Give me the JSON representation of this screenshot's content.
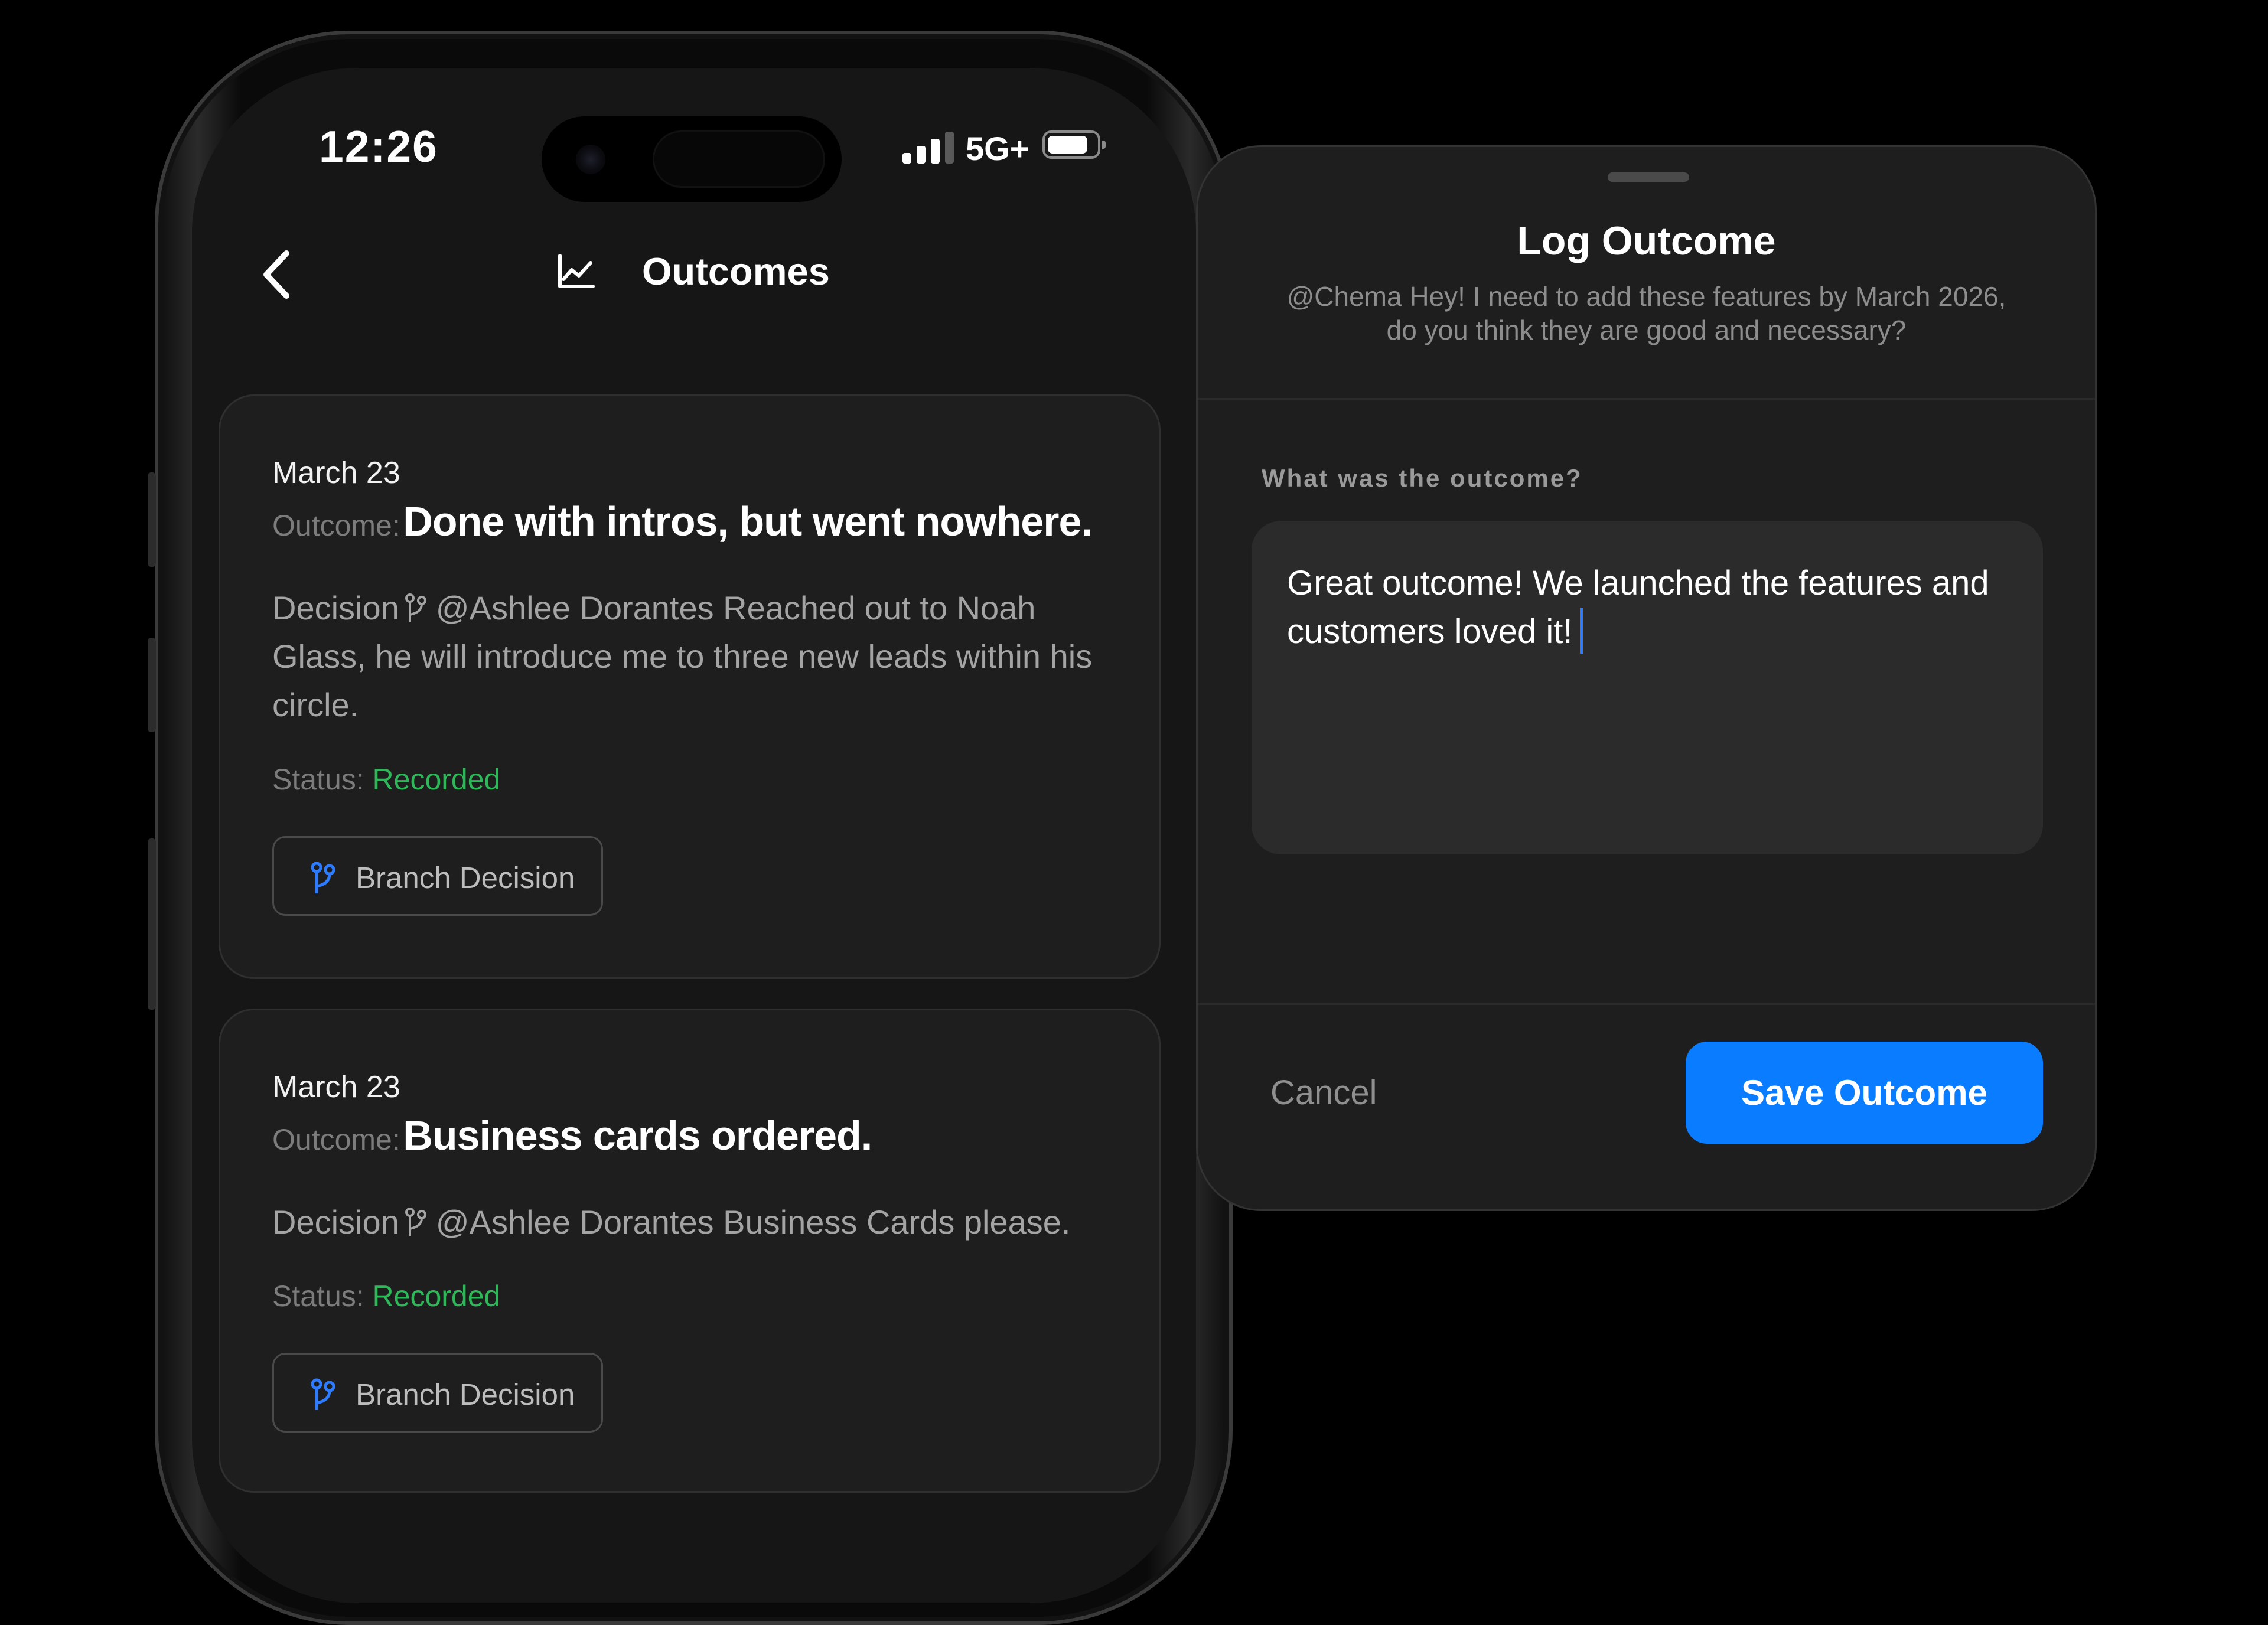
{
  "status_bar": {
    "time": "12:26",
    "network": "5G+",
    "signal_bars": 4,
    "signal_bars_active": 3,
    "battery_level": 0.8
  },
  "nav": {
    "title": "Outcomes",
    "back_icon": "chevron-left-icon",
    "title_icon": "trend-chart-icon"
  },
  "cards": [
    {
      "date": "March 23",
      "outcome_label": "Outcome:",
      "outcome": "Done with intros, but went nowhere.",
      "decision_label": "Decision",
      "decision_text": "@Ashlee Dorantes Reached out to Noah Glass, he will introduce me to three new leads within his circle.",
      "status_label": "Status:",
      "status": "Recorded",
      "button_label": "Branch Decision"
    },
    {
      "date": "March 23",
      "outcome_label": "Outcome:",
      "outcome": "Business cards ordered.",
      "decision_label": "Decision",
      "decision_text": "@Ashlee Dorantes Business Cards please.",
      "status_label": "Status:",
      "status": "Recorded",
      "button_label": "Branch Decision"
    }
  ],
  "sheet": {
    "title": "Log Outcome",
    "subtitle": "@Chema Hey! I need to add these features by March 2026, do you think they are good and necessary?",
    "field_label": "What was the outcome?",
    "field_value": "Great outcome! We launched the features and customers loved it!",
    "cancel_label": "Cancel",
    "save_label": "Save Outcome"
  },
  "colors": {
    "accent": "#0a7cff",
    "status_green": "#2fb85a",
    "branch_icon": "#2d7bff",
    "card_bg": "#1e1e1e"
  }
}
